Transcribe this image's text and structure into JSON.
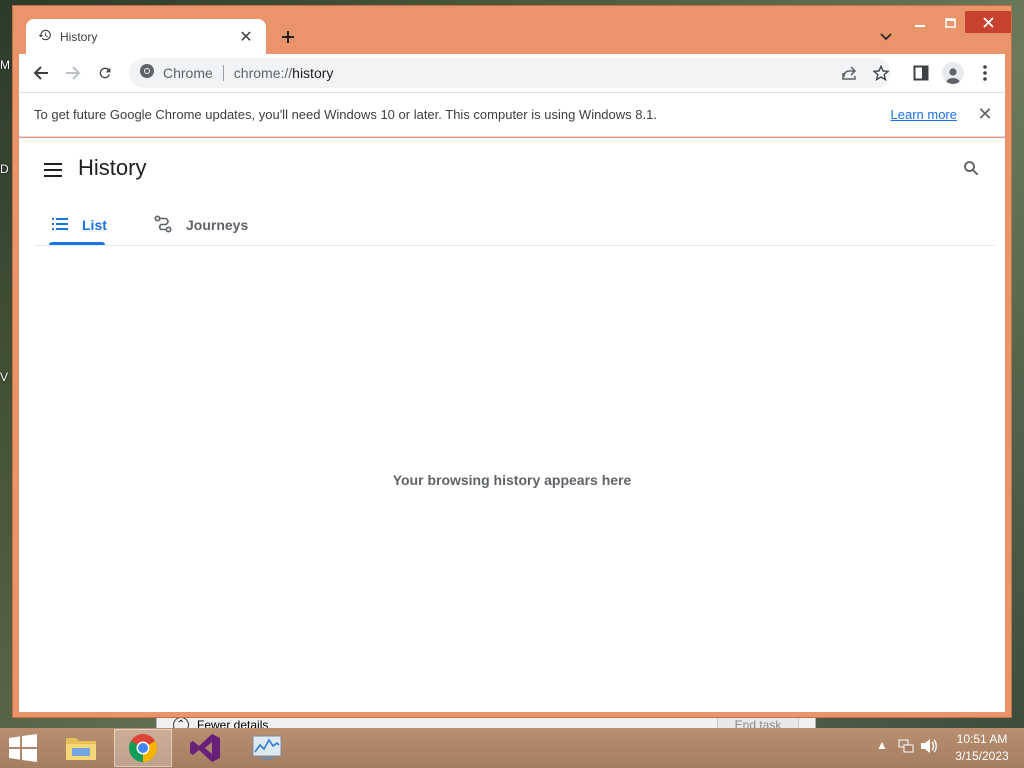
{
  "desktop": {
    "edge_labels": [
      "M",
      "D",
      "V"
    ]
  },
  "task_manager": {
    "fewer_details": "Fewer details",
    "end_task": "End task"
  },
  "browser": {
    "tab": {
      "title": "History",
      "icon": "history-icon"
    },
    "omnibox": {
      "scheme_label": "Chrome",
      "url_prefix": "chrome://",
      "url_host": "history"
    },
    "infobar": {
      "message": "To get future Google Chrome updates, you'll need Windows 10 or later. This computer is using Windows 8.1.",
      "link": "Learn more"
    },
    "colors": {
      "frame": "#e9946b",
      "accent": "#1a73e8",
      "close": "#c8432f"
    }
  },
  "history_page": {
    "title": "History",
    "tabs": [
      {
        "label": "List",
        "icon": "list-icon",
        "active": true
      },
      {
        "label": "Journeys",
        "icon": "journeys-icon",
        "active": false
      }
    ],
    "empty_message": "Your browsing history appears here"
  },
  "taskbar": {
    "apps": [
      "file-explorer",
      "google-chrome",
      "visual-studio",
      "performance-monitor"
    ],
    "clock": {
      "time": "10:51 AM",
      "date": "3/15/2023"
    }
  }
}
